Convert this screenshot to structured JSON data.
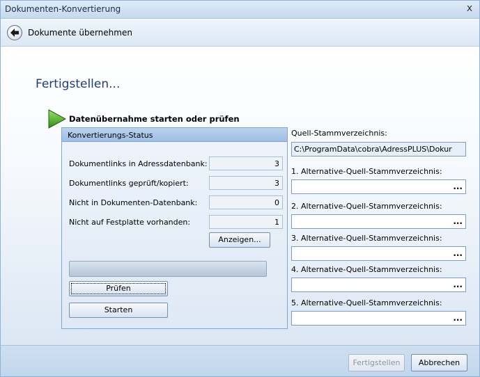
{
  "window": {
    "title": "Dokumenten-Konvertierung",
    "close_glyph": "x"
  },
  "nav": {
    "back_icon": "back-arrow-icon",
    "title": "Dokumente übernehmen"
  },
  "page": {
    "heading": "Fertigstellen..."
  },
  "section": {
    "icon": "green-play-icon",
    "title": "Datenübernahme starten oder prüfen"
  },
  "status": {
    "header": "Konvertierungs-Status",
    "rows": [
      {
        "label": "Dokumentlinks in Adressdatenbank:",
        "value": "3"
      },
      {
        "label": "Dokumentlinks geprüft/kopiert:",
        "value": "3"
      },
      {
        "label": "Nicht in Dokumenten-Datenbank:",
        "value": "0"
      },
      {
        "label": "Nicht auf Festplatte vorhanden:",
        "value": "1"
      }
    ],
    "show_button": "Anzeigen...",
    "progress": 0,
    "check_button": "Prüfen",
    "start_button": "Starten"
  },
  "source": {
    "label": "Quell-Stammverzeichnis:",
    "value": "C:\\ProgramData\\cobra\\AdressPLUS\\Dokur"
  },
  "alternatives": [
    {
      "label": "1. Alternative-Quell-Stammverzeichnis:",
      "value": ""
    },
    {
      "label": "2. Alternative-Quell-Stammverzeichnis:",
      "value": ""
    },
    {
      "label": "3. Alternative-Quell-Stammverzeichnis:",
      "value": ""
    },
    {
      "label": "4. Alternative-Quell-Stammverzeichnis:",
      "value": ""
    },
    {
      "label": "5. Alternative-Quell-Stammverzeichnis:",
      "value": ""
    }
  ],
  "browse_label": "...",
  "footer": {
    "finish_button": "Fertigstellen",
    "cancel_button": "Abbrechen"
  }
}
